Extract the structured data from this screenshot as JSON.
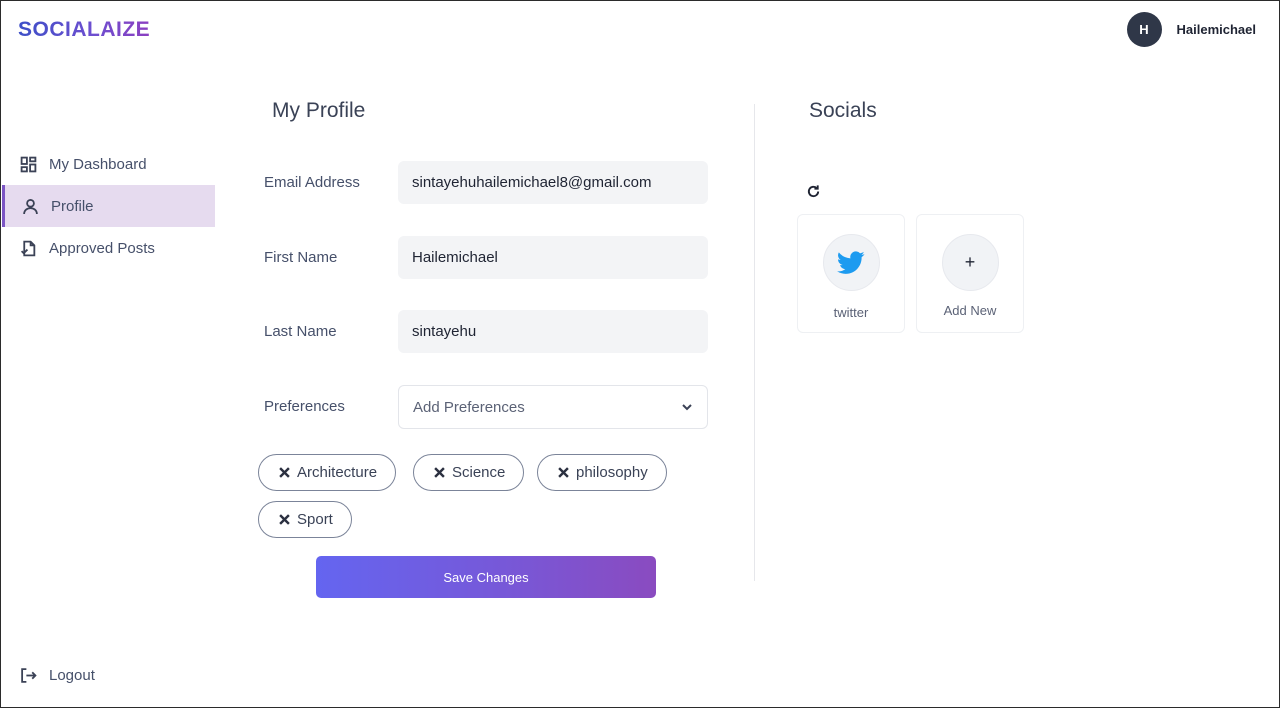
{
  "brand": {
    "logo": "SOCIALAIZE"
  },
  "user": {
    "initial": "H",
    "name": "Hailemichael"
  },
  "sidebar": {
    "items": [
      {
        "label": "My Dashboard",
        "icon": "dashboard-icon",
        "active": false
      },
      {
        "label": "Profile",
        "icon": "user-icon",
        "active": true
      },
      {
        "label": "Approved Posts",
        "icon": "document-icon",
        "active": false
      }
    ],
    "logout": "Logout"
  },
  "profile": {
    "title": "My Profile",
    "email_label": "Email Address",
    "email_value": "sintayehuhailemichael8@gmail.com",
    "first_name_label": "First Name",
    "first_name_value": "Hailemichael",
    "last_name_label": "Last Name",
    "last_name_value": "sintayehu",
    "preferences_label": "Preferences",
    "preferences_placeholder": "Add Preferences",
    "chips": [
      "Architecture",
      "Science",
      "philosophy",
      "Sport"
    ],
    "save_label": "Save Changes"
  },
  "socials": {
    "title": "Socials",
    "cards": [
      {
        "label": "twitter",
        "icon": "twitter-icon"
      },
      {
        "label": "Add New",
        "icon": "plus-icon",
        "glyph": "+"
      }
    ]
  },
  "colors": {
    "accent": "#7c55c4",
    "active_bg": "#e6dbef",
    "twitter": "#1d9bf0",
    "button_gradient_start": "#6465f0",
    "button_gradient_end": "#8a4bc0"
  }
}
